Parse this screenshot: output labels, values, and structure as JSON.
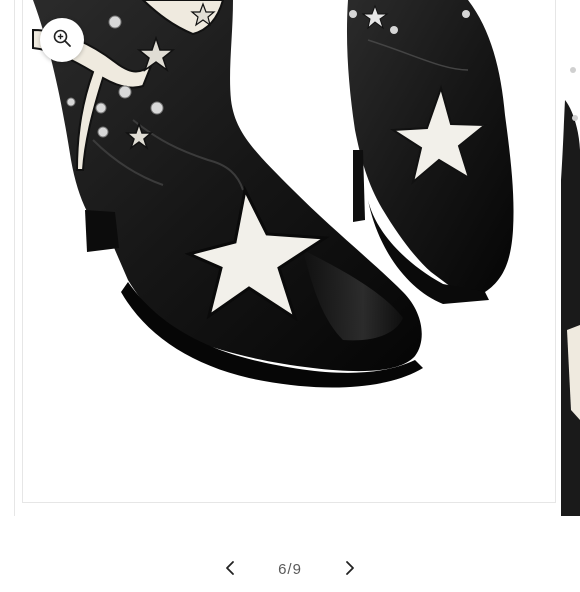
{
  "product_gallery": {
    "image_alt": "",
    "zoom_icon": "magnifier-plus-icon",
    "prev_icon": "chevron-left-icon",
    "next_icon": "chevron-right-icon",
    "pagination": {
      "text": "6/9"
    }
  }
}
